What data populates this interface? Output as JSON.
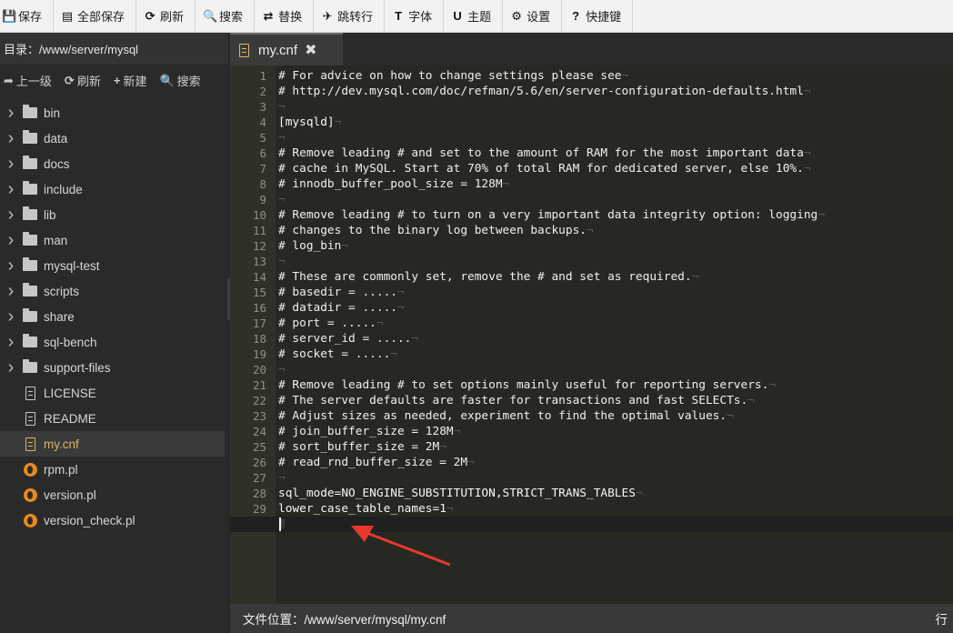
{
  "toolbar": [
    {
      "icon": "save-icon",
      "glyph": "💾",
      "label": "保存"
    },
    {
      "icon": "save-all-icon",
      "glyph": "▤",
      "label": "全部保存"
    },
    {
      "icon": "refresh-icon",
      "glyph": "⟳",
      "label": "刷新"
    },
    {
      "icon": "search-icon",
      "glyph": "🔍",
      "label": "搜索"
    },
    {
      "icon": "replace-icon",
      "glyph": "⇄",
      "label": "替换"
    },
    {
      "icon": "goto-line-icon",
      "glyph": "✈",
      "label": "跳转行"
    },
    {
      "icon": "font-icon",
      "glyph": "T",
      "label": "字体"
    },
    {
      "icon": "theme-icon",
      "glyph": "U",
      "label": "主题"
    },
    {
      "icon": "settings-icon",
      "glyph": "⚙",
      "label": "设置"
    },
    {
      "icon": "shortcuts-icon",
      "glyph": "?",
      "label": "快捷键"
    }
  ],
  "sidebar": {
    "directory_label": "目录：/www/server/mysql",
    "actions": [
      {
        "icon": "up-level-icon",
        "glyph": "➦",
        "label": "上一级"
      },
      {
        "icon": "refresh-icon",
        "glyph": "⟳",
        "label": "刷新"
      },
      {
        "icon": "plus-icon",
        "glyph": "+",
        "label": "新建"
      },
      {
        "icon": "search-icon",
        "glyph": "🔍",
        "label": "搜索"
      }
    ],
    "items": [
      {
        "type": "folder",
        "name": "bin"
      },
      {
        "type": "folder",
        "name": "data"
      },
      {
        "type": "folder",
        "name": "docs"
      },
      {
        "type": "folder",
        "name": "include"
      },
      {
        "type": "folder",
        "name": "lib"
      },
      {
        "type": "folder",
        "name": "man"
      },
      {
        "type": "folder",
        "name": "mysql-test"
      },
      {
        "type": "folder",
        "name": "scripts"
      },
      {
        "type": "folder",
        "name": "share"
      },
      {
        "type": "folder",
        "name": "sql-bench"
      },
      {
        "type": "folder",
        "name": "support-files"
      },
      {
        "type": "file",
        "name": "LICENSE"
      },
      {
        "type": "file",
        "name": "README"
      },
      {
        "type": "file-active",
        "name": "my.cnf",
        "selected": true
      },
      {
        "type": "perl",
        "name": "rpm.pl"
      },
      {
        "type": "perl",
        "name": "version.pl"
      },
      {
        "type": "perl",
        "name": "version_check.pl"
      }
    ]
  },
  "tab": {
    "label": "my.cnf",
    "close_glyph": "✖"
  },
  "editor": {
    "lines": [
      "# For advice on how to change settings please see",
      "# http://dev.mysql.com/doc/refman/5.6/en/server-configuration-defaults.html",
      "",
      "[mysqld]",
      "",
      "# Remove leading # and set to the amount of RAM for the most important data",
      "# cache in MySQL. Start at 70% of total RAM for dedicated server, else 10%.",
      "# innodb_buffer_pool_size = 128M",
      "",
      "# Remove leading # to turn on a very important data integrity option: logging",
      "# changes to the binary log between backups.",
      "# log_bin",
      "",
      "# These are commonly set, remove the # and set as required.",
      "# basedir = .....",
      "# datadir = .....",
      "# port = .....",
      "# server_id = .....",
      "# socket = .....",
      "",
      "# Remove leading # to set options mainly useful for reporting servers.",
      "# The server defaults are faster for transactions and fast SELECTs.",
      "# Adjust sizes as needed, experiment to find the optimal values.",
      "# join_buffer_size = 128M",
      "# sort_buffer_size = 2M",
      "# read_rnd_buffer_size = 2M",
      "",
      "sql_mode=NO_ENGINE_SUBSTITUTION,STRICT_TRANS_TABLES",
      "lower_case_table_names=1",
      ""
    ],
    "active_line": 30
  },
  "status": {
    "file_location": "文件位置：/www/server/mysql/my.cnf",
    "right": "行"
  },
  "colors": {
    "annotation_arrow": "#e8392e",
    "selected_file": "#d8b765"
  }
}
